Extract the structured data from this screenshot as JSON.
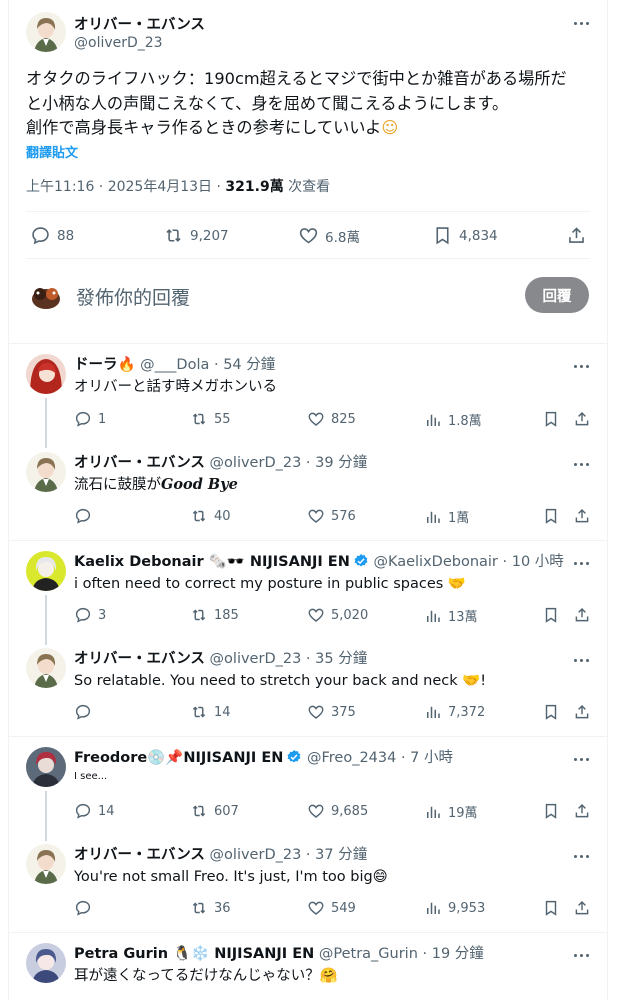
{
  "main_tweet": {
    "author_name": "オリバー・エバンス",
    "handle": "@oliverD_23",
    "text_line1": "オタクのライフハック：190cm超えるとマジで街中とか雑音がある場所だ",
    "text_line2": "と小柄な人の声聞こえなくて、身を屈めて聞こえるようにします。",
    "text_line3": "創作で高身長キャラ作るときの参考にしていいよ",
    "emoji": "☺",
    "translate": "翻譯貼文",
    "time": "上午11:16 · 2025年4月13日 · ",
    "views_count": "321.9萬",
    "views_label": " 次查看",
    "replies": "88",
    "retweets": "9,207",
    "likes": "6.8萬",
    "bookmarks": "4,834"
  },
  "compose": {
    "placeholder": "發佈你的回覆",
    "reply_button": "回覆"
  },
  "replies": [
    {
      "name": "ドーラ🔥",
      "handle": "@___Dola",
      "time": "· 54 分鐘",
      "text": "オリバーと話す時メガホンいる",
      "replies": "1",
      "retweets": "55",
      "likes": "825",
      "views": "1.8萬"
    },
    {
      "name": "オリバー・エバンス",
      "handle": "@oliverD_23",
      "time": "· 39 分鐘",
      "text": "流石に鼓膜が",
      "text_styled": "𝑮𝒐𝒐𝒅 𝑩𝒚𝒆",
      "replies": "",
      "retweets": "40",
      "likes": "576",
      "views": "1萬"
    },
    {
      "name": "Kaelix Debonair 🗞️🕶️ NIJISANJI EN",
      "handle": "@KaelixDebonair",
      "time": "· 10 小時",
      "text": "i often need to correct my posture in public spaces 🤝",
      "replies": "3",
      "retweets": "185",
      "likes": "5,020",
      "views": "13萬"
    },
    {
      "name": "オリバー・エバンス",
      "handle": "@oliverD_23",
      "time": "· 35 分鐘",
      "text": "So relatable. You need to stretch your back and neck 🤝!",
      "replies": "",
      "retweets": "14",
      "likes": "375",
      "views": "7,372"
    },
    {
      "name": "Freodore💿📌NIJISANJI EN",
      "handle": "@Freo_2434",
      "time": "· 7 小時",
      "text": "I see...",
      "replies": "14",
      "retweets": "607",
      "likes": "9,685",
      "views": "19萬"
    },
    {
      "name": "オリバー・エバンス",
      "handle": "@oliverD_23",
      "time": "· 37 分鐘",
      "text": "You're not small Freo. It's just, I'm too big😄",
      "replies": "",
      "retweets": "36",
      "likes": "549",
      "views": "9,953"
    },
    {
      "name": "Petra Gurin 🐧❄️ NIJISANJI EN",
      "handle": "@Petra_Gurin",
      "time": "· 19 分鐘",
      "text": "耳が遠くなってるだけなんじゃない？🤗"
    }
  ],
  "colors": {
    "text": "#0f1419",
    "muted": "#536471",
    "link": "#1d9bf0",
    "reply_button_bg": "#87898c",
    "verified": "#1d9bf0"
  },
  "icons": [
    "more-icon",
    "reply-icon",
    "retweet-icon",
    "like-icon",
    "views-icon",
    "bookmark-icon",
    "share-icon",
    "verified-icon"
  ]
}
